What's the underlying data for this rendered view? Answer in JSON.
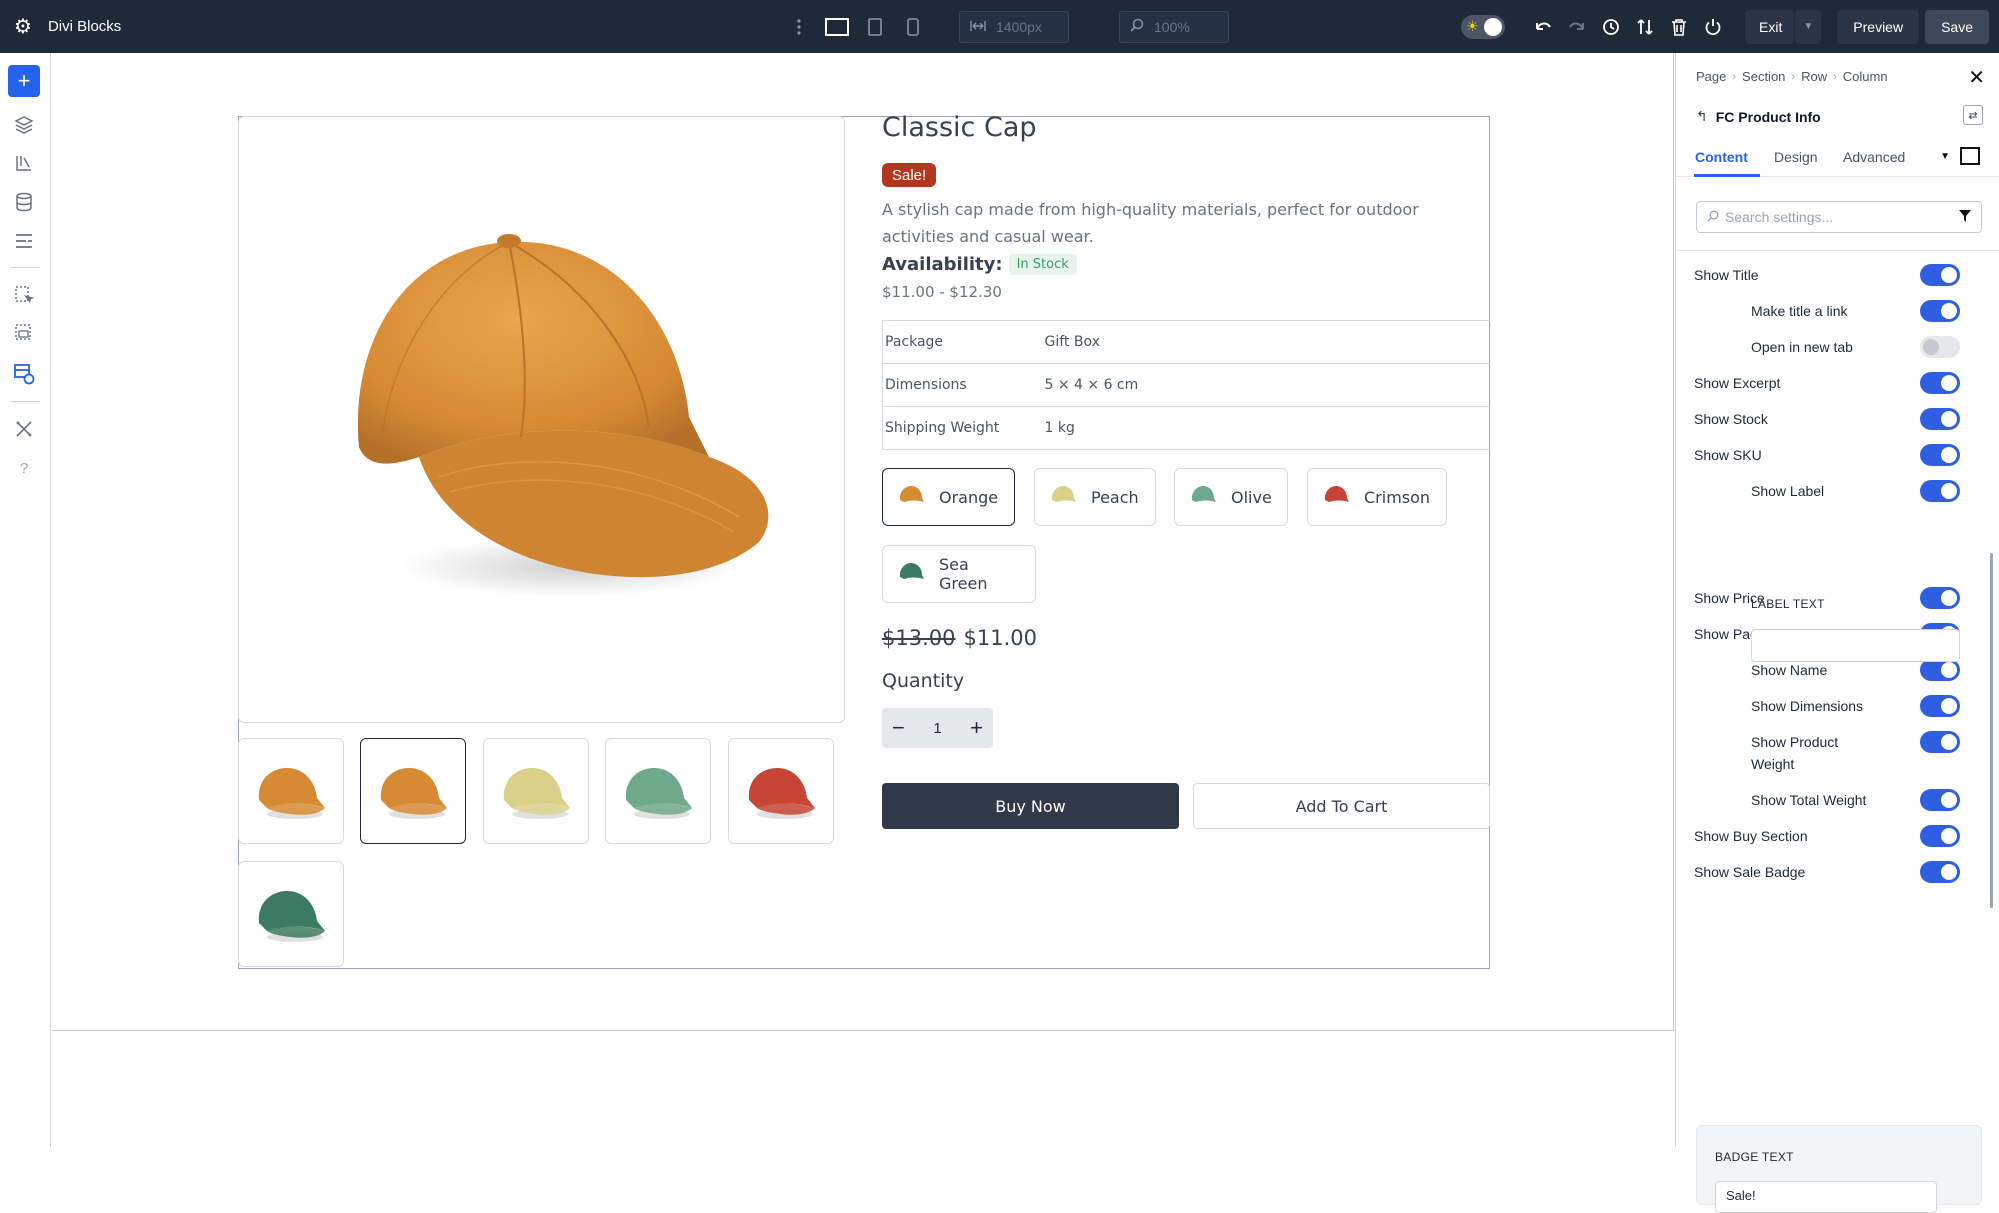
{
  "topbar": {
    "app_title": "Divi Blocks",
    "width_value": "1400px",
    "zoom_value": "100%",
    "exit_label": "Exit",
    "preview_label": "Preview",
    "save_label": "Save"
  },
  "product": {
    "title": "Classic Cap",
    "sale_badge": "Sale!",
    "description": "A stylish cap made from high-quality materials, perfect for outdoor activities and casual wear.",
    "availability_label": "Availability:",
    "stock_status": "In Stock",
    "price_range": "$11.00 - $12.30",
    "specs": [
      {
        "label": "Package",
        "value": "Gift Box"
      },
      {
        "label": "Dimensions",
        "value": "5 × 4 × 6 cm"
      },
      {
        "label": "Shipping Weight",
        "value": "1 kg"
      }
    ],
    "variants": [
      {
        "label": "Orange",
        "color": "#d68a33"
      },
      {
        "label": "Peach",
        "color": "#d9d08a"
      },
      {
        "label": "Olive",
        "color": "#6fa88a"
      },
      {
        "label": "Crimson",
        "color": "#c64535"
      },
      {
        "label": "Sea Green",
        "color": "#3d7a64"
      }
    ],
    "selected_variant": "Orange",
    "old_price": "$13.00",
    "new_price": "$11.00",
    "quantity_label": "Quantity",
    "quantity": "1",
    "buy_now_label": "Buy Now",
    "add_to_cart_label": "Add To Cart",
    "thumbnails": [
      "#d68a33",
      "#d68a33",
      "#d9d08a",
      "#6fa88a",
      "#c64535",
      "#3d7a64"
    ]
  },
  "panel": {
    "breadcrumb": [
      "Page",
      "Section",
      "Row",
      "Column"
    ],
    "module_name": "FC Product Info",
    "tabs": [
      "Content",
      "Design",
      "Advanced"
    ],
    "active_tab": "Content",
    "search_placeholder": "Search settings...",
    "settings": [
      {
        "label": "Show Title",
        "on": true,
        "indent": false
      },
      {
        "label": "Make title a link",
        "on": true,
        "indent": true
      },
      {
        "label": "Open in new tab",
        "on": false,
        "indent": true
      },
      {
        "label": "Show Excerpt",
        "on": true,
        "indent": false
      },
      {
        "label": "Show Stock",
        "on": true,
        "indent": false
      },
      {
        "label": "Show SKU",
        "on": true,
        "indent": false
      },
      {
        "label": "Show Label",
        "on": true,
        "indent": true
      },
      {
        "label": "Show Price",
        "on": true,
        "indent": false
      },
      {
        "label": "Show Package Info",
        "on": true,
        "indent": false
      },
      {
        "label": "Show Name",
        "on": true,
        "indent": true
      },
      {
        "label": "Show Dimensions",
        "on": true,
        "indent": true
      },
      {
        "label": "Show Product",
        "label2": "Weight",
        "on": true,
        "indent": true
      },
      {
        "label": "Show Total Weight",
        "on": true,
        "indent": true
      },
      {
        "label": "Show Buy Section",
        "on": true,
        "indent": false
      },
      {
        "label": "Show Sale Badge",
        "on": true,
        "indent": false
      }
    ],
    "label_text_heading": "LABEL TEXT",
    "label_text_value": "",
    "badge_text_heading": "BADGE TEXT",
    "badge_text_value": "Sale!"
  }
}
